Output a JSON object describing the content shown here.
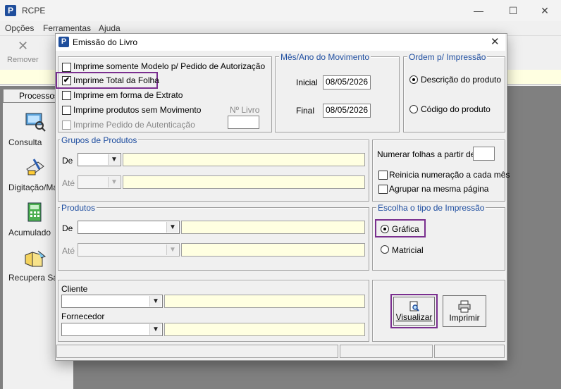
{
  "app": {
    "title": "RCPE",
    "icon_letter": "P",
    "minimize": "—",
    "maximize": "☐",
    "close": "✕"
  },
  "menu": [
    "Opções",
    "Ferramentas",
    "Ajuda"
  ],
  "toolbar": {
    "remover_label": "Remover",
    "remover_icon": "✕"
  },
  "sidebar": {
    "tab": "Processos",
    "items": [
      {
        "label": "Consulta",
        "icon": "consulta-icon"
      },
      {
        "label": "Digitação/Ma",
        "icon": "digitacao-icon"
      },
      {
        "label": "Acumulado",
        "icon": "acumulado-icon"
      },
      {
        "label": "Recupera Sal",
        "icon": "recupera-icon"
      }
    ]
  },
  "dialog": {
    "title": "Emissão do Livro",
    "icon_letter": "P",
    "close": "✕",
    "options": [
      {
        "label": "Imprime somente Modelo p/ Pedido de Autorização",
        "checked": false,
        "enabled": true
      },
      {
        "label": "Imprime Total da Folha",
        "checked": true,
        "enabled": true
      },
      {
        "label": "Imprime em forma de Extrato",
        "checked": false,
        "enabled": true
      },
      {
        "label": "Imprime produtos sem Movimento",
        "checked": false,
        "enabled": true
      },
      {
        "label": "Imprime Pedido de Autenticação",
        "checked": false,
        "enabled": false
      }
    ],
    "num_livro_label": "Nº Livro",
    "num_livro_value": "",
    "mes_ano": {
      "legend": "Mês/Ano do Movimento",
      "inicial_label": "Inicial",
      "inicial_value": "08/05/2026",
      "final_label": "Final",
      "final_value": "08/05/2026"
    },
    "ordem": {
      "legend": "Ordem p/ Impressão",
      "options": [
        "Descrição do produto",
        "Código do produto"
      ],
      "selected": 0
    },
    "grupos": {
      "legend": "Grupos de Produtos",
      "de_label": "De",
      "ate_label": "Até"
    },
    "numerar": {
      "label": "Numerar folhas a partir de",
      "value": "",
      "reinicia": "Reinicia numeração a cada mês",
      "agrupar": "Agrupar na mesma página"
    },
    "produtos": {
      "legend": "Produtos",
      "de_label": "De",
      "ate_label": "Até"
    },
    "tipo": {
      "legend": "Escolha o tipo de Impressão",
      "options": [
        "Gráfica",
        "Matricial"
      ],
      "selected": 0
    },
    "cliente_label": "Cliente",
    "fornecedor_label": "Fornecedor",
    "visualizar_label": "Visualizar",
    "imprimir_label": "Imprimir"
  },
  "colors": {
    "legend": "#1f4ea0",
    "highlight": "#7a2f8f",
    "yellow_field": "#ffffe1",
    "brand": "#1f4e9c"
  }
}
